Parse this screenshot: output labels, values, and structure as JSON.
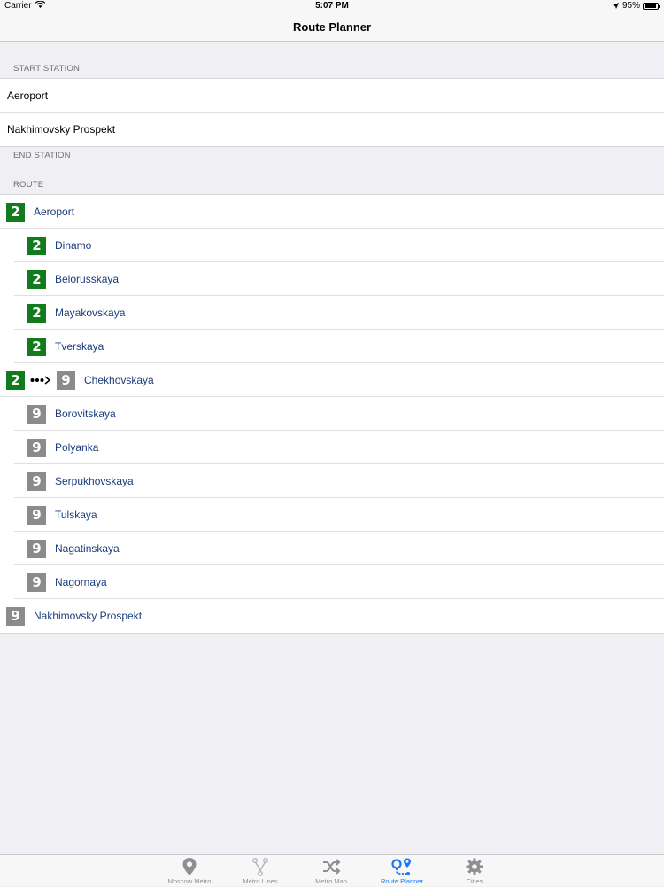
{
  "status_bar": {
    "carrier": "Carrier",
    "time": "5:07 PM",
    "battery": "95%",
    "battery_level": 0.95
  },
  "nav": {
    "title": "Route Planner"
  },
  "start_section": {
    "header": "START STATION",
    "items": [
      "Aeroport",
      "Nakhimovsky Prospekt"
    ]
  },
  "end_section": {
    "header": "END STATION"
  },
  "route_section": {
    "header": "ROUTE",
    "stops": [
      {
        "name": "Aeroport",
        "line": "2",
        "kind": "endpoint"
      },
      {
        "name": "Dinamo",
        "line": "2",
        "kind": "intermediate"
      },
      {
        "name": "Belorusskaya",
        "line": "2",
        "kind": "intermediate"
      },
      {
        "name": "Mayakovskaya",
        "line": "2",
        "kind": "intermediate"
      },
      {
        "name": "Tverskaya",
        "line": "2",
        "kind": "intermediate"
      },
      {
        "name": "Chekhovskaya",
        "line": "9",
        "from_line": "2",
        "kind": "transfer"
      },
      {
        "name": "Borovitskaya",
        "line": "9",
        "kind": "intermediate"
      },
      {
        "name": "Polyanka",
        "line": "9",
        "kind": "intermediate"
      },
      {
        "name": "Serpukhovskaya",
        "line": "9",
        "kind": "intermediate"
      },
      {
        "name": "Tulskaya",
        "line": "9",
        "kind": "intermediate"
      },
      {
        "name": "Nagatinskaya",
        "line": "9",
        "kind": "intermediate"
      },
      {
        "name": "Nagornaya",
        "line": "9",
        "kind": "intermediate"
      },
      {
        "name": "Nakhimovsky Prospekt",
        "line": "9",
        "kind": "endpoint"
      }
    ]
  },
  "colors": {
    "line_2": "#127b1d",
    "line_9": "#8b8b8b",
    "route_text": "#1a3d7c",
    "tab_active": "#1a7aef",
    "tab_inactive": "#929292"
  },
  "tab_bar": {
    "tabs": [
      {
        "label": "Moscow Metro",
        "icon": "map-pin-icon",
        "active": false
      },
      {
        "label": "Metro Lines",
        "icon": "metro-lines-icon",
        "active": false
      },
      {
        "label": "Metro Map",
        "icon": "shuffle-icon",
        "active": false
      },
      {
        "label": "Route Planner",
        "icon": "route-planner-icon",
        "active": true
      },
      {
        "label": "Cities",
        "icon": "gear-icon",
        "active": false
      }
    ]
  }
}
